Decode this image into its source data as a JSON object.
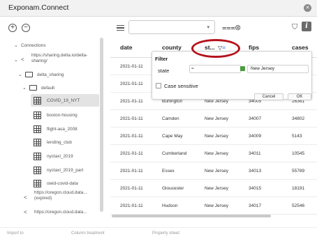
{
  "window": {
    "title": "Exponam.Connect"
  },
  "toolbar": {
    "add_symbol": "+",
    "remove_symbol": "−",
    "search_value": "",
    "chevron": "▾",
    "filter_glyph": "⩶",
    "clear_glyph": "⊗",
    "shield_glyph": "⛉",
    "info_glyph": "i"
  },
  "sidebar": {
    "items": [
      {
        "label": "Connections",
        "kind": "root"
      },
      {
        "label": "https://sharing.delta.io/delta-sharing/",
        "kind": "share"
      },
      {
        "label": "delta_sharing",
        "kind": "folder"
      },
      {
        "label": "default",
        "kind": "folder"
      },
      {
        "label": "COVID_19_NYT",
        "kind": "table",
        "selected": true
      },
      {
        "label": "boston-housing",
        "kind": "table"
      },
      {
        "label": "flight-asa_2008",
        "kind": "table"
      },
      {
        "label": "lending_club",
        "kind": "table"
      },
      {
        "label": "nyctaxi_2019",
        "kind": "table"
      },
      {
        "label": "nyctaxi_2019_part",
        "kind": "table"
      },
      {
        "label": "owid-covid-data",
        "kind": "table"
      },
      {
        "label": "https://oregon.cloud.data... (expired)",
        "kind": "share"
      },
      {
        "label": "https://oregon.cloud.data...",
        "kind": "share"
      }
    ]
  },
  "table": {
    "columns": [
      "date",
      "county",
      "st...",
      "fips",
      "cases"
    ],
    "rows": [
      [
        "2021-01-11",
        "",
        "",
        "",
        ""
      ],
      [
        "2021-01-11",
        "",
        "",
        "",
        ""
      ],
      [
        "2021-01-11",
        "Burlington",
        "New Jersey",
        "34005",
        "26361"
      ],
      [
        "2021-01-11",
        "Camden",
        "New Jersey",
        "34007",
        "34802"
      ],
      [
        "2021-01-11",
        "Cape May",
        "New Jersey",
        "34009",
        "5143"
      ],
      [
        "2021-01-11",
        "Cumberland",
        "New Jersey",
        "34011",
        "10545"
      ],
      [
        "2021-01-11",
        "Essex",
        "New Jersey",
        "34013",
        "55789"
      ],
      [
        "2021-01-11",
        "Gloucester",
        "New Jersey",
        "34015",
        "18191"
      ],
      [
        "2021-01-11",
        "Hudson",
        "New Jersey",
        "34017",
        "52546"
      ]
    ]
  },
  "filter_popup": {
    "title": "Filter",
    "column": "state",
    "operator": "=",
    "value": "New Jersey",
    "case_label": "Case sensitive",
    "cancel_label": "Cancel",
    "ok_label": "OK"
  },
  "bottom": {
    "tabs": [
      "Import to",
      "Column treatment",
      "Property sheet"
    ]
  },
  "colors": {
    "highlight_oval": "#b5121b",
    "stepper_green": "#4a9d40"
  }
}
